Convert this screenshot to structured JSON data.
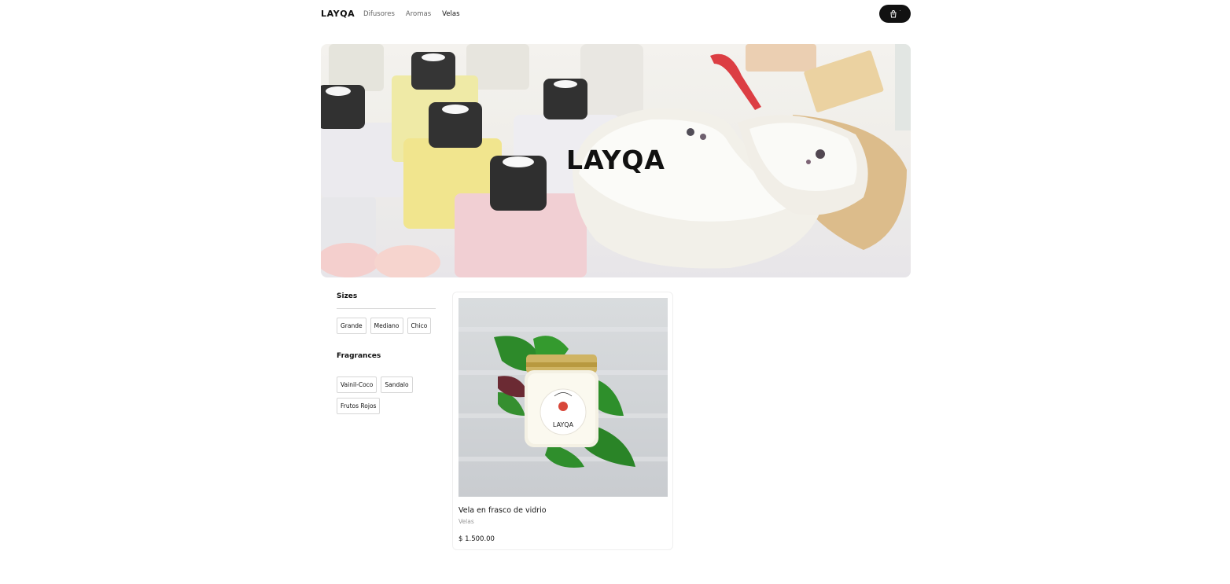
{
  "nav": {
    "brand": "LAYQA",
    "links": [
      {
        "label": "Difusores",
        "active": false
      },
      {
        "label": "Aromas",
        "active": false
      },
      {
        "label": "Velas",
        "active": true
      }
    ],
    "cart_count": "·",
    "cart_icon": "shopping-bag-icon"
  },
  "hero": {
    "title": "LAYQA"
  },
  "filters": {
    "sizes_title": "Sizes",
    "sizes": [
      "Grande",
      "Mediano",
      "Chico"
    ],
    "fragrances_title": "Fragrances",
    "fragrances": [
      "Vainil-Coco",
      "Sandalo",
      "Frutos Rojos"
    ]
  },
  "product": {
    "name": "Vela en frasco de vidrio",
    "category": "Velas",
    "price": "$ 1.500.00",
    "label_text": "LAYQA"
  },
  "colors": {
    "accent": "#111111",
    "muted_text": "#999999",
    "chip_border": "#d6d6d6"
  }
}
